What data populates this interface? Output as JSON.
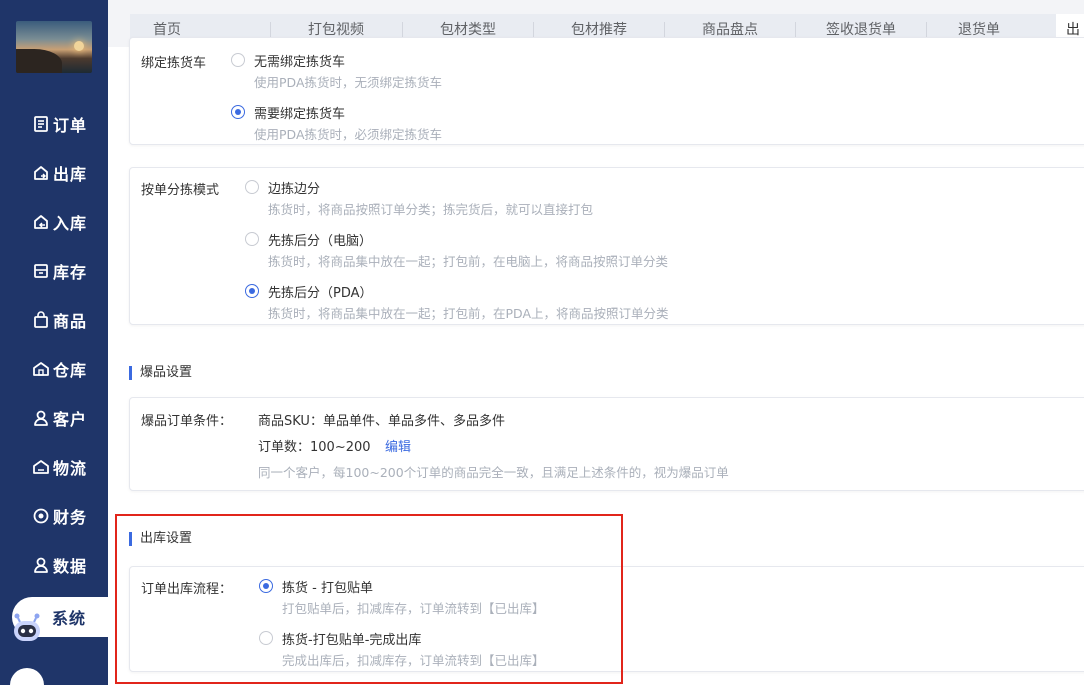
{
  "sidebar": {
    "items": [
      {
        "label": "订单",
        "icon": "document-icon"
      },
      {
        "label": "出库",
        "icon": "house-out-icon"
      },
      {
        "label": "入库",
        "icon": "house-in-icon"
      },
      {
        "label": "库存",
        "icon": "inventory-icon"
      },
      {
        "label": "商品",
        "icon": "bag-icon"
      },
      {
        "label": "仓库",
        "icon": "warehouse-icon"
      },
      {
        "label": "客户",
        "icon": "user-icon"
      },
      {
        "label": "物流",
        "icon": "truck-icon"
      },
      {
        "label": "财务",
        "icon": "finance-icon"
      },
      {
        "label": "数据",
        "icon": "data-icon"
      },
      {
        "label": "系统",
        "icon": "robot-icon"
      }
    ],
    "active": "系统"
  },
  "tabs": [
    "首页",
    "打包视频",
    "包材类型",
    "包材推荐",
    "商品盘点",
    "签收退货单",
    "退货单",
    "出"
  ],
  "bind_cart": {
    "label": "绑定拣货车",
    "options": [
      {
        "title": "无需绑定拣货车",
        "desc": "使用PDA拣货时，无须绑定拣货车",
        "checked": false
      },
      {
        "title": "需要绑定拣货车",
        "desc": "使用PDA拣货时，必须绑定拣货车",
        "checked": true
      }
    ]
  },
  "sort_mode": {
    "label": "按单分拣模式",
    "options": [
      {
        "title": "边拣边分",
        "desc": "拣货时，将商品按照订单分类；拣完货后，就可以直接打包",
        "checked": false
      },
      {
        "title": "先拣后分（电脑）",
        "desc": "拣货时，将商品集中放在一起；打包前，在电脑上，将商品按照订单分类",
        "checked": false
      },
      {
        "title": "先拣后分（PDA）",
        "desc": "拣货时，将商品集中放在一起；打包前，在PDA上，将商品按照订单分类",
        "checked": true
      }
    ]
  },
  "hot_section": {
    "title": "爆品设置",
    "label": "爆品订单条件：",
    "sku_line": "商品SKU：单品单件、单品多件、多品多件",
    "count_line": "订单数：100~200",
    "edit_link": "编辑",
    "desc": "同一个客户，每100~200个订单的商品完全一致，且满足上述条件的，视为爆品订单"
  },
  "outbound_section": {
    "title": "出库设置",
    "label": "订单出库流程：",
    "options": [
      {
        "title": "拣货 - 打包贴单",
        "desc": "打包贴单后，扣减库存，订单流转到【已出库】",
        "checked": true
      },
      {
        "title": "拣货-打包贴单-完成出库",
        "desc": "完成出库后，扣减库存，订单流转到【已出库】",
        "checked": false
      }
    ]
  },
  "colors": {
    "sidebar": "#1f3569",
    "accent": "#3b6ae0",
    "highlight": "#e1251b"
  }
}
